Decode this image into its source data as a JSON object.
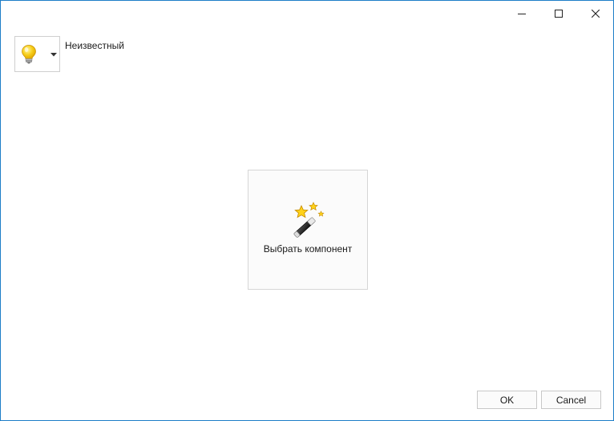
{
  "window": {
    "controls": {
      "minimize_icon": "minimize-icon",
      "maximize_icon": "maximize-icon",
      "close_icon": "close-icon"
    }
  },
  "type_selector": {
    "icon": "lightbulb-icon",
    "label": "Неизвестный"
  },
  "pick_component": {
    "icon": "magic-wand-icon",
    "label": "Выбрать компонент"
  },
  "buttons": {
    "ok_label": "OK",
    "cancel_label": "Cancel"
  },
  "colors": {
    "window_border": "#1e7ec8",
    "bulb": "#f5c400",
    "star": "#ffd21a"
  }
}
